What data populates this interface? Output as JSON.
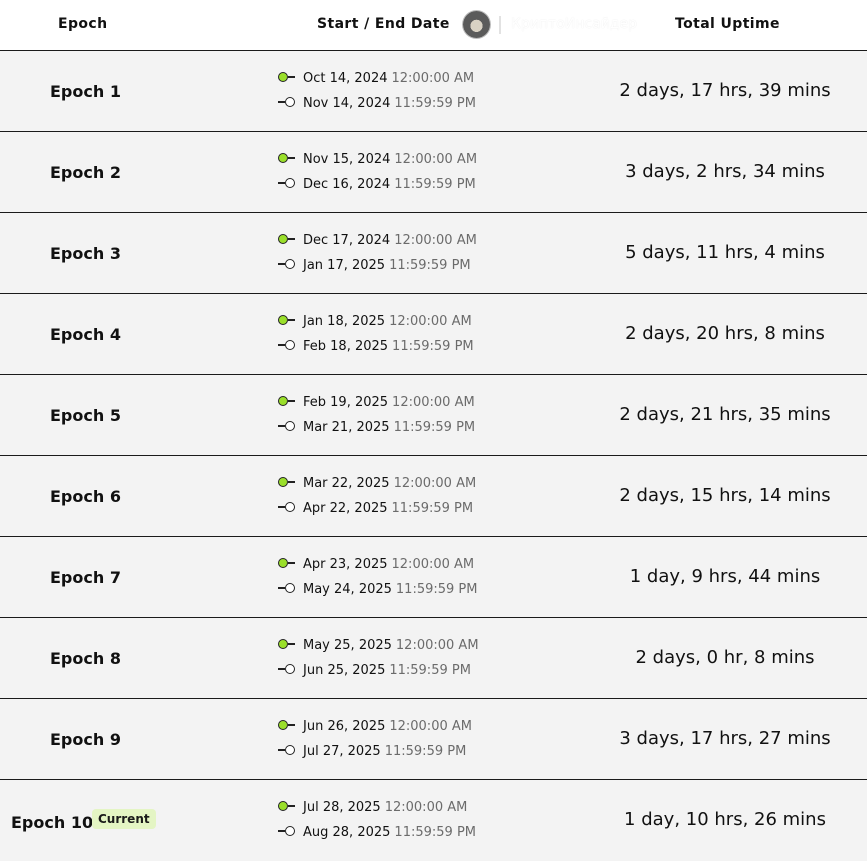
{
  "header": {
    "epoch_label": "Epoch",
    "dates_label": "Start / End Date",
    "uptime_label": "Total Uptime",
    "watermark_text": "КриптоИнсайдер"
  },
  "rows": [
    {
      "epoch": "Epoch 1",
      "start_date": "Oct 14, 2024",
      "start_time": "12:00:00 AM",
      "end_date": "Nov 14, 2024",
      "end_time": "11:59:59 PM",
      "uptime": "2 days, 17 hrs, 39 mins"
    },
    {
      "epoch": "Epoch 2",
      "start_date": "Nov 15, 2024",
      "start_time": "12:00:00 AM",
      "end_date": "Dec 16, 2024",
      "end_time": "11:59:59 PM",
      "uptime": "3 days, 2 hrs, 34 mins"
    },
    {
      "epoch": "Epoch 3",
      "start_date": "Dec 17, 2024",
      "start_time": "12:00:00 AM",
      "end_date": "Jan 17, 2025",
      "end_time": "11:59:59 PM",
      "uptime": "5 days, 11 hrs, 4 mins"
    },
    {
      "epoch": "Epoch 4",
      "start_date": "Jan 18, 2025",
      "start_time": "12:00:00 AM",
      "end_date": "Feb 18, 2025",
      "end_time": "11:59:59 PM",
      "uptime": "2 days, 20 hrs, 8 mins"
    },
    {
      "epoch": "Epoch 5",
      "start_date": "Feb 19, 2025",
      "start_time": "12:00:00 AM",
      "end_date": "Mar 21, 2025",
      "end_time": "11:59:59 PM",
      "uptime": "2 days, 21 hrs, 35 mins"
    },
    {
      "epoch": "Epoch 6",
      "start_date": "Mar 22, 2025",
      "start_time": "12:00:00 AM",
      "end_date": "Apr 22, 2025",
      "end_time": "11:59:59 PM",
      "uptime": "2 days, 15 hrs, 14 mins"
    },
    {
      "epoch": "Epoch 7",
      "start_date": "Apr 23, 2025",
      "start_time": "12:00:00 AM",
      "end_date": "May 24, 2025",
      "end_time": "11:59:59 PM",
      "uptime": "1 day, 9 hrs, 44 mins"
    },
    {
      "epoch": "Epoch 8",
      "start_date": "May 25, 2025",
      "start_time": "12:00:00 AM",
      "end_date": "Jun 25, 2025",
      "end_time": "11:59:59 PM",
      "uptime": "2 days, 0 hr, 8 mins"
    },
    {
      "epoch": "Epoch 9",
      "start_date": "Jun 26, 2025",
      "start_time": "12:00:00 AM",
      "end_date": "Jul 27, 2025",
      "end_time": "11:59:59 PM",
      "uptime": "3 days, 17 hrs, 27 mins"
    },
    {
      "epoch": "Epoch 10",
      "badge": "Current",
      "start_date": "Jul 28, 2025",
      "start_time": "12:00:00 AM",
      "end_date": "Aug 28, 2025",
      "end_time": "11:59:59 PM",
      "uptime": "1 day, 10 hrs, 26 mins"
    }
  ],
  "colors": {
    "start_marker": "#9adf2a",
    "current_badge_bg": "#e4f5c4",
    "background": "#f3f3f3",
    "header_background": "#ffffff"
  }
}
